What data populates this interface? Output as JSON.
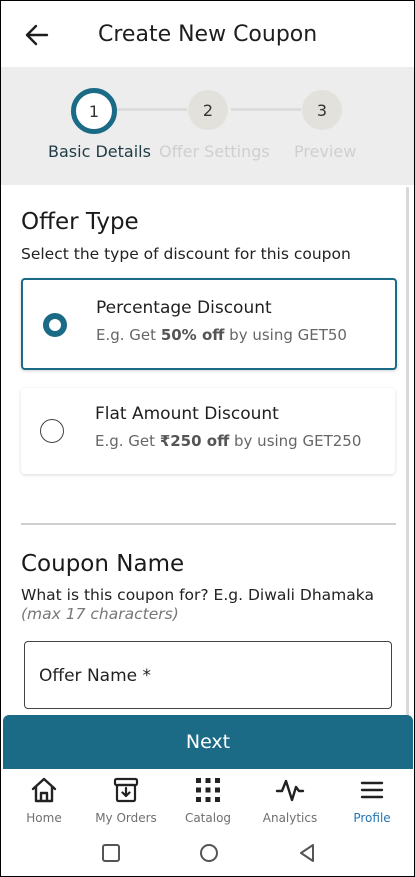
{
  "header": {
    "title": "Create New Coupon",
    "back_icon": "arrow-left-icon"
  },
  "stepper": {
    "steps": [
      {
        "number": "1",
        "label": "Basic Details",
        "active": true
      },
      {
        "number": "2",
        "label": "Offer Settings",
        "active": false
      },
      {
        "number": "3",
        "label": "Preview",
        "active": false
      }
    ]
  },
  "offer_type": {
    "title": "Offer Type",
    "description": "Select the type of discount for this coupon",
    "options": [
      {
        "title": "Percentage Discount",
        "sub_prefix": "E.g. Get ",
        "sub_bold": "50% off",
        "sub_suffix": " by using GET50",
        "selected": true
      },
      {
        "title": "Flat Amount Discount",
        "sub_prefix": "E.g. Get ",
        "sub_bold": "₹250 off",
        "sub_suffix": " by using GET250",
        "selected": false
      }
    ]
  },
  "coupon_name": {
    "title": "Coupon Name",
    "description": "What is this coupon for? E.g. Diwali Dhamaka ",
    "hint": "(max 17 characters)",
    "input_label": "Offer Name *"
  },
  "next_button": {
    "label": "Next"
  },
  "bottom_nav": {
    "items": [
      {
        "label": "Home",
        "icon": "home-icon",
        "active": false
      },
      {
        "label": "My Orders",
        "icon": "orders-box-icon",
        "active": false
      },
      {
        "label": "Catalog",
        "icon": "grid-dots-icon",
        "active": false
      },
      {
        "label": "Analytics",
        "icon": "pulse-chart-icon",
        "active": false
      },
      {
        "label": "Profile",
        "icon": "menu-lines-icon",
        "active": true
      }
    ]
  },
  "system_nav": {
    "recents_icon": "square-icon",
    "home_icon": "circle-icon",
    "back_icon": "triangle-back-icon"
  },
  "colors": {
    "primary": "#1c6b86",
    "active_nav": "#2476b5",
    "stepper_bg": "#ededed"
  }
}
